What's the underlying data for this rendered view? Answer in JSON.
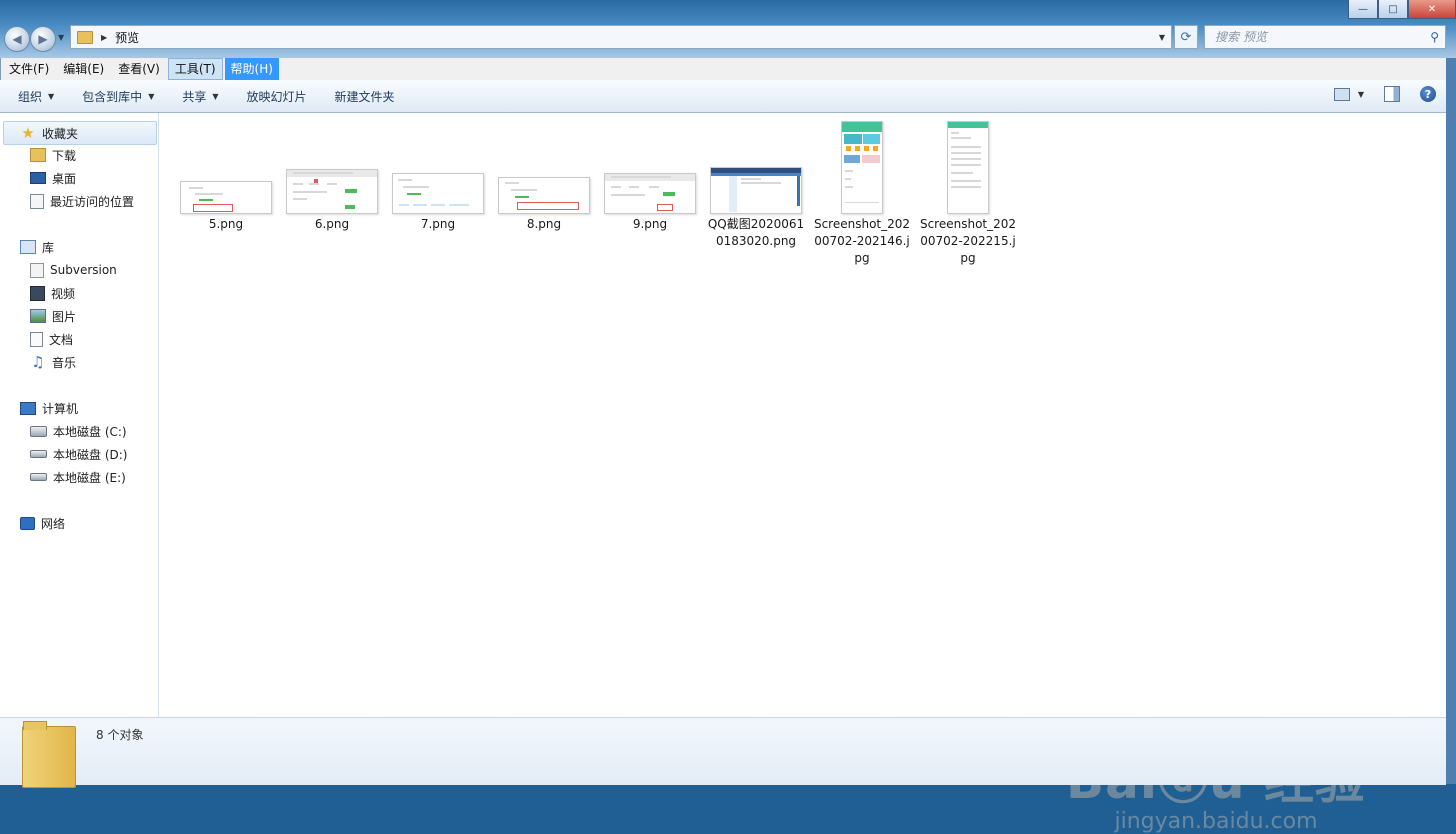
{
  "window": {
    "controls": [
      "—",
      "□",
      "✕"
    ]
  },
  "address": {
    "crumb": "预览"
  },
  "search": {
    "placeholder": "搜索 预览"
  },
  "menu": [
    "文件(F)",
    "编辑(E)",
    "查看(V)",
    "工具(T)",
    "帮助(H)"
  ],
  "toolbar": {
    "organize": "组织",
    "include_in_library": "包含到库中",
    "share": "共享",
    "slideshow": "放映幻灯片",
    "new_folder": "新建文件夹"
  },
  "nav": {
    "favorites": "收藏夹",
    "downloads": "下载",
    "desktop": "桌面",
    "recent": "最近访问的位置",
    "libraries": "库",
    "subversion": "Subversion",
    "videos": "视频",
    "pictures": "图片",
    "documents": "文档",
    "music": "音乐",
    "computer": "计算机",
    "drive_c": "本地磁盘 (C:)",
    "drive_d": "本地磁盘 (D:)",
    "drive_e": "本地磁盘 (E:)",
    "network": "网络"
  },
  "files": [
    {
      "name": "5.png"
    },
    {
      "name": "6.png"
    },
    {
      "name": "7.png"
    },
    {
      "name": "8.png"
    },
    {
      "name": "9.png"
    },
    {
      "name": "QQ截图20200610183020.png"
    },
    {
      "name": "Screenshot_20200702-202146.jpg"
    },
    {
      "name": "Screenshot_20200702-202215.jpg"
    }
  ],
  "status": {
    "count": "8 个对象"
  },
  "watermark": {
    "brand": "Baiⓓu 经验",
    "url": "jingyan.baidu.com"
  }
}
